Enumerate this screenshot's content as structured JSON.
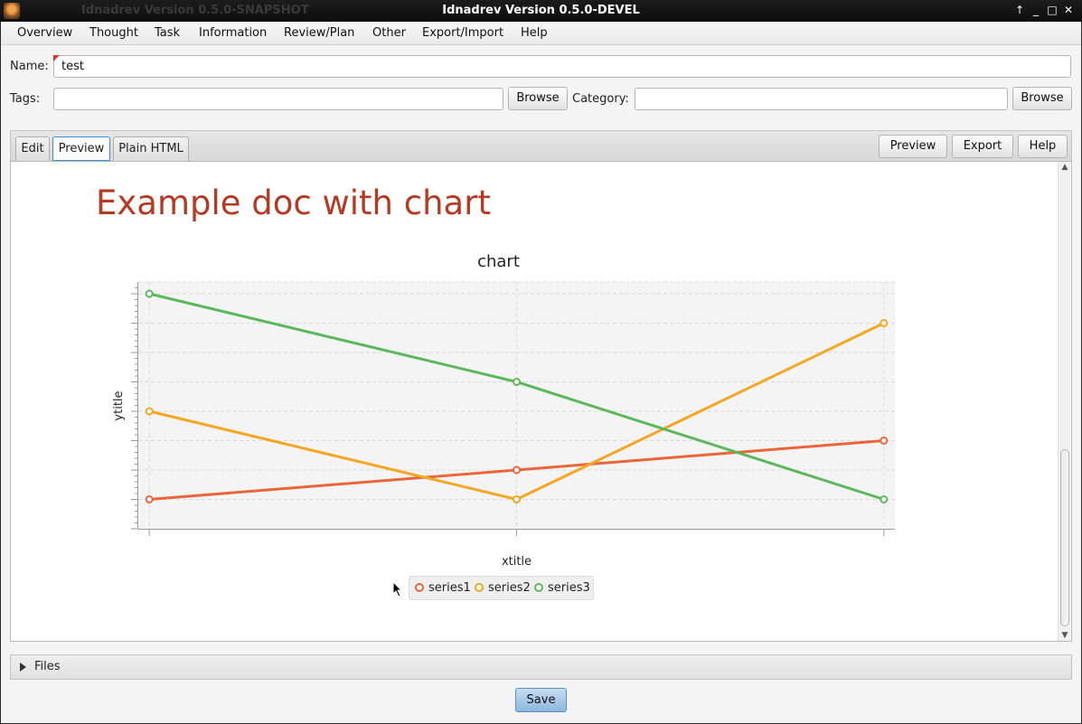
{
  "titlebar": {
    "ghost_title": "Idnadrev Version 0.5.0-SNAPSHOT",
    "title": "Idnadrev Version 0.5.0-DEVEL",
    "buttons": {
      "up": "↑",
      "minimize": "_",
      "maximize": "□",
      "close": "✕"
    }
  },
  "menu": [
    "Overview",
    "Thought",
    "Task",
    "Information",
    "Review/Plan",
    "Other",
    "Export/Import",
    "Help"
  ],
  "form": {
    "name_label": "Name:",
    "name_value": "test",
    "tags_label": "Tags:",
    "tags_value": "",
    "tags_browse": "Browse",
    "category_label": "Category:",
    "category_value": "",
    "category_browse": "Browse"
  },
  "tabs": {
    "edit": "Edit",
    "preview": "Preview",
    "plain_html": "Plain HTML",
    "active": "Preview"
  },
  "actions": {
    "preview": "Preview",
    "export": "Export",
    "help": "Help"
  },
  "document": {
    "title": "Example doc with chart",
    "title_color": "#b43a24"
  },
  "chart_data": {
    "type": "line",
    "title": "chart",
    "xlabel": "xtitle",
    "ylabel": "ytitle",
    "x": [
      1,
      2,
      3
    ],
    "series": [
      {
        "name": "series1",
        "color": "#e8663a",
        "values": [
          1,
          2,
          3
        ]
      },
      {
        "name": "series2",
        "color": "#f5a623",
        "values": [
          4,
          1,
          7
        ]
      },
      {
        "name": "series3",
        "color": "#5cb85c",
        "values": [
          8,
          5,
          1
        ]
      }
    ],
    "ylim": [
      0,
      8.4
    ],
    "xlim": [
      0.97,
      3.03
    ],
    "grid": true,
    "legend": "bottom",
    "tick_labels_shown": false
  },
  "files": {
    "label": "Files"
  },
  "save": "Save"
}
